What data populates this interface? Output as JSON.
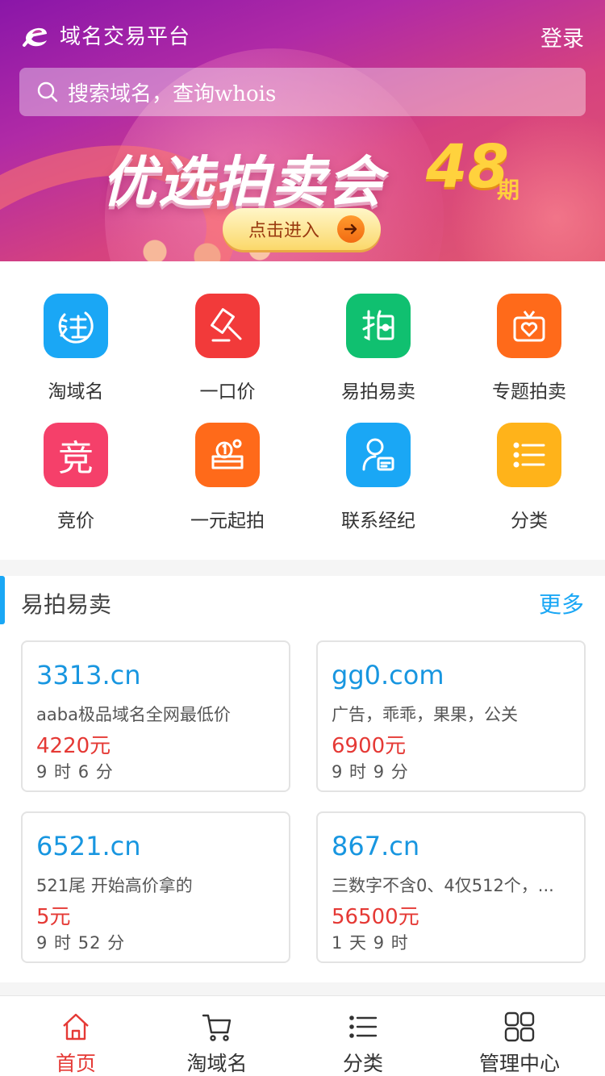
{
  "header": {
    "app_title": "域名交易平台",
    "login_label": "登录",
    "search_placeholder": "搜索域名，查询whois"
  },
  "banner": {
    "title": "优选拍卖会",
    "issue_number": "48",
    "issue_unit": "期",
    "button_label": "点击进入"
  },
  "menu": [
    {
      "label": "淘域名",
      "color": "#1aa7f5",
      "icon": "tao-icon"
    },
    {
      "label": "一口价",
      "color": "#f23a3a",
      "icon": "gavel-icon"
    },
    {
      "label": "易拍易卖",
      "color": "#10c070",
      "icon": "pai-icon"
    },
    {
      "label": "专题拍卖",
      "color": "#ff6a1a",
      "icon": "gift-box-icon"
    },
    {
      "label": "竞价",
      "color": "#f5406a",
      "icon": "jing-icon"
    },
    {
      "label": "一元起拍",
      "color": "#ff6a1a",
      "icon": "coin-icon"
    },
    {
      "label": "联系经纪",
      "color": "#1aa7f5",
      "icon": "agent-icon"
    },
    {
      "label": "分类",
      "color": "#ffb31a",
      "icon": "list-icon"
    }
  ],
  "section": {
    "title": "易拍易卖",
    "more_label": "更多",
    "cards": [
      {
        "domain": "3313.cn",
        "desc": "aaba极品域名全网最低价",
        "price": "4220元",
        "time": "9 时 6 分"
      },
      {
        "domain": "gg0.com",
        "desc": "广告，乖乖，果果，公关",
        "price": "6900元",
        "time": "9 时 9 分"
      },
      {
        "domain": "6521.cn",
        "desc": "521尾 开始高价拿的",
        "price": "5元",
        "time": "9 时 52 分"
      },
      {
        "domain": "867.cn",
        "desc": "三数字不含0、4仅512个，...",
        "price": "56500元",
        "time": "1 天 9 时"
      }
    ]
  },
  "tabbar": [
    {
      "label": "首页",
      "active": true,
      "icon": "home-icon"
    },
    {
      "label": "淘域名",
      "active": false,
      "icon": "cart-icon"
    },
    {
      "label": "分类",
      "active": false,
      "icon": "list-icon"
    },
    {
      "label": "管理中心",
      "active": false,
      "icon": "grid-icon"
    }
  ],
  "colors": {
    "accent": "#1aa7f5",
    "price": "#e53935",
    "active_tab": "#e53935"
  }
}
